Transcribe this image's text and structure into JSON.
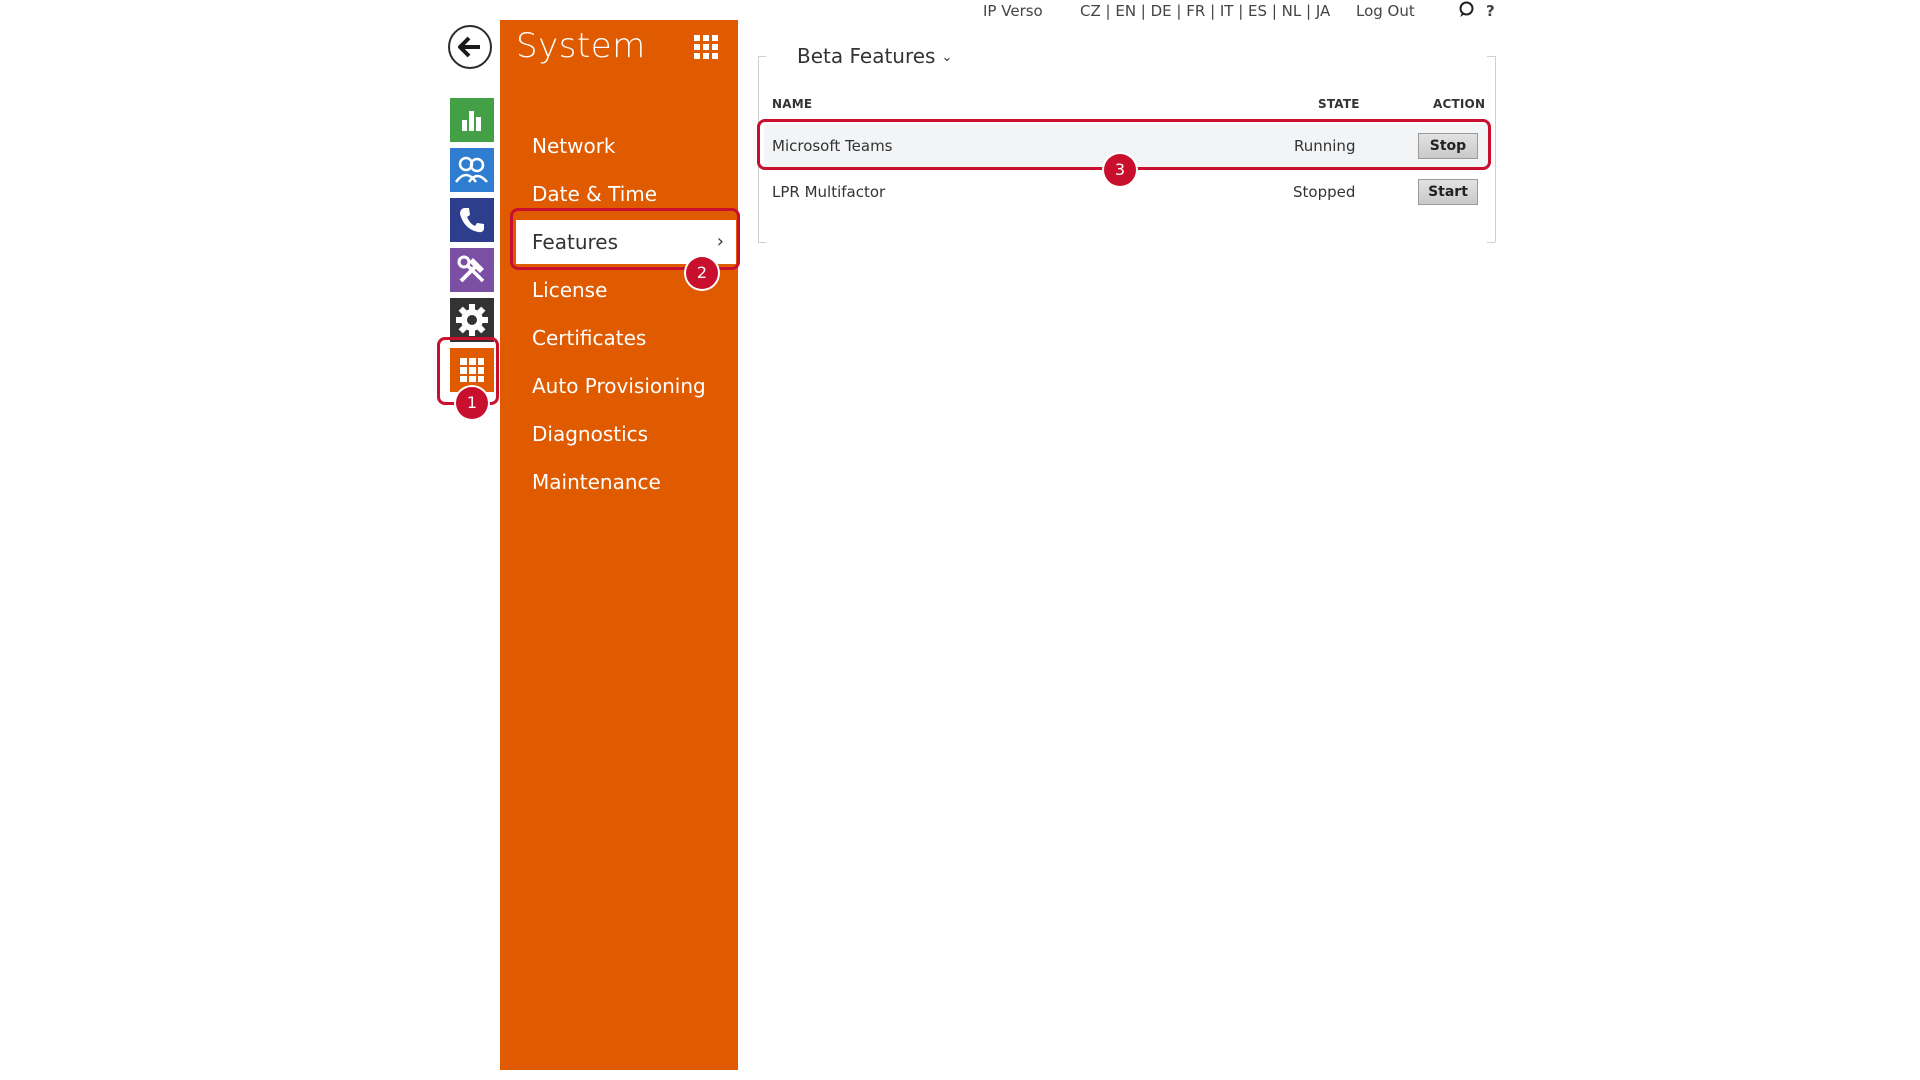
{
  "topbar": {
    "device": "IP Verso",
    "languages": "CZ | EN | DE | FR | IT | ES | NL | JA",
    "logout": "Log Out",
    "chat_icon": "speech-bubble-icon",
    "help": "?"
  },
  "iconbar": {
    "back_icon": "arrow-left-icon",
    "apps": [
      {
        "name": "status",
        "icon": "bar-chart-icon",
        "color": "#43a047"
      },
      {
        "name": "directory",
        "icon": "users-icon",
        "color": "#2f7dd1"
      },
      {
        "name": "calls",
        "icon": "phone-icon",
        "color": "#2d3e8c"
      },
      {
        "name": "services",
        "icon": "tools-icon",
        "color": "#7b4fa3"
      },
      {
        "name": "hardware",
        "icon": "gear-icon",
        "color": "#333333"
      },
      {
        "name": "system",
        "icon": "grid-icon",
        "color": "#e05a00",
        "selected": true
      }
    ]
  },
  "sysmenu": {
    "title": "System",
    "grid_icon": "grid-icon",
    "items": [
      {
        "label": "Network"
      },
      {
        "label": "Date & Time"
      },
      {
        "label": "Features",
        "active": true,
        "chevron": "›"
      },
      {
        "label": "License"
      },
      {
        "label": "Certificates"
      },
      {
        "label": "Auto Provisioning"
      },
      {
        "label": "Diagnostics"
      },
      {
        "label": "Maintenance"
      }
    ],
    "color": "#e05a00"
  },
  "content": {
    "section_select": "Beta Features",
    "section_chevron": "⌄",
    "columns": {
      "name": "NAME",
      "state": "STATE",
      "action": "ACTION"
    },
    "rows": [
      {
        "name": "Microsoft Teams",
        "state": "Running",
        "action": "Stop"
      },
      {
        "name": "LPR Multifactor",
        "state": "Stopped",
        "action": "Start"
      }
    ]
  },
  "annotations": {
    "color": "#c8102e",
    "badges": [
      "1",
      "2",
      "3"
    ]
  }
}
